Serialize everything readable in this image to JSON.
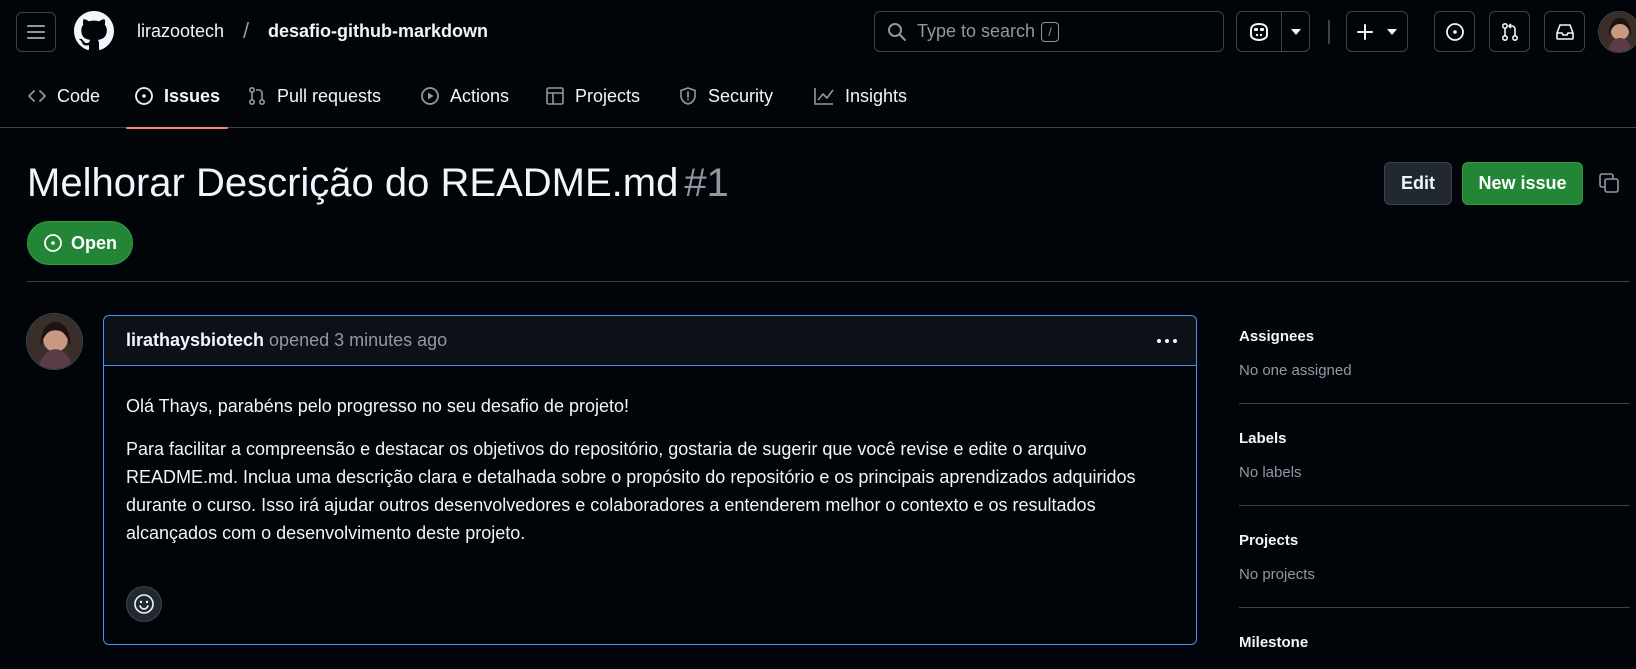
{
  "header": {
    "owner": "lirazootech",
    "separator": "/",
    "repo": "desafio-github-markdown",
    "search_placeholder": "Type to search",
    "search_shortcut": "/"
  },
  "tabs": [
    {
      "label": "Code",
      "icon": "code-icon"
    },
    {
      "label": "Issues",
      "icon": "issue-opened-icon",
      "active": true
    },
    {
      "label": "Pull requests",
      "icon": "git-pull-request-icon"
    },
    {
      "label": "Actions",
      "icon": "play-icon"
    },
    {
      "label": "Projects",
      "icon": "table-icon"
    },
    {
      "label": "Security",
      "icon": "shield-icon"
    },
    {
      "label": "Insights",
      "icon": "graph-icon"
    }
  ],
  "issue": {
    "title": "Melhorar Descrição do README.md",
    "number": "#1",
    "state": "Open",
    "edit_label": "Edit",
    "new_issue_label": "New issue"
  },
  "comment": {
    "author": "lirathaysbiotech",
    "meta": "opened 3 minutes ago",
    "paragraphs": [
      "Olá Thays, parabéns pelo progresso no seu desafio de projeto!",
      "Para facilitar a compreensão e destacar os objetivos do repositório, gostaria de sugerir que você revise e edite o arquivo README.md. Inclua uma descrição clara e detalhada sobre o propósito do repositório e os principais aprendizados adquiridos durante o curso. Isso irá ajudar outros desenvolvedores e colaboradores a entenderem melhor o contexto e os resultados alcançados com o desenvolvimento deste projeto."
    ]
  },
  "sidebar": {
    "assignees": {
      "heading": "Assignees",
      "value": "No one assigned"
    },
    "labels": {
      "heading": "Labels",
      "value": "No labels"
    },
    "projects": {
      "heading": "Projects",
      "value": "No projects"
    },
    "milestone": {
      "heading": "Milestone"
    }
  },
  "colors": {
    "background": "#010409",
    "border": "#3d444d",
    "accent_green": "#238636",
    "accent_blue": "#4493f8",
    "tab_underline": "#f78166",
    "muted_text": "#9198a1"
  }
}
